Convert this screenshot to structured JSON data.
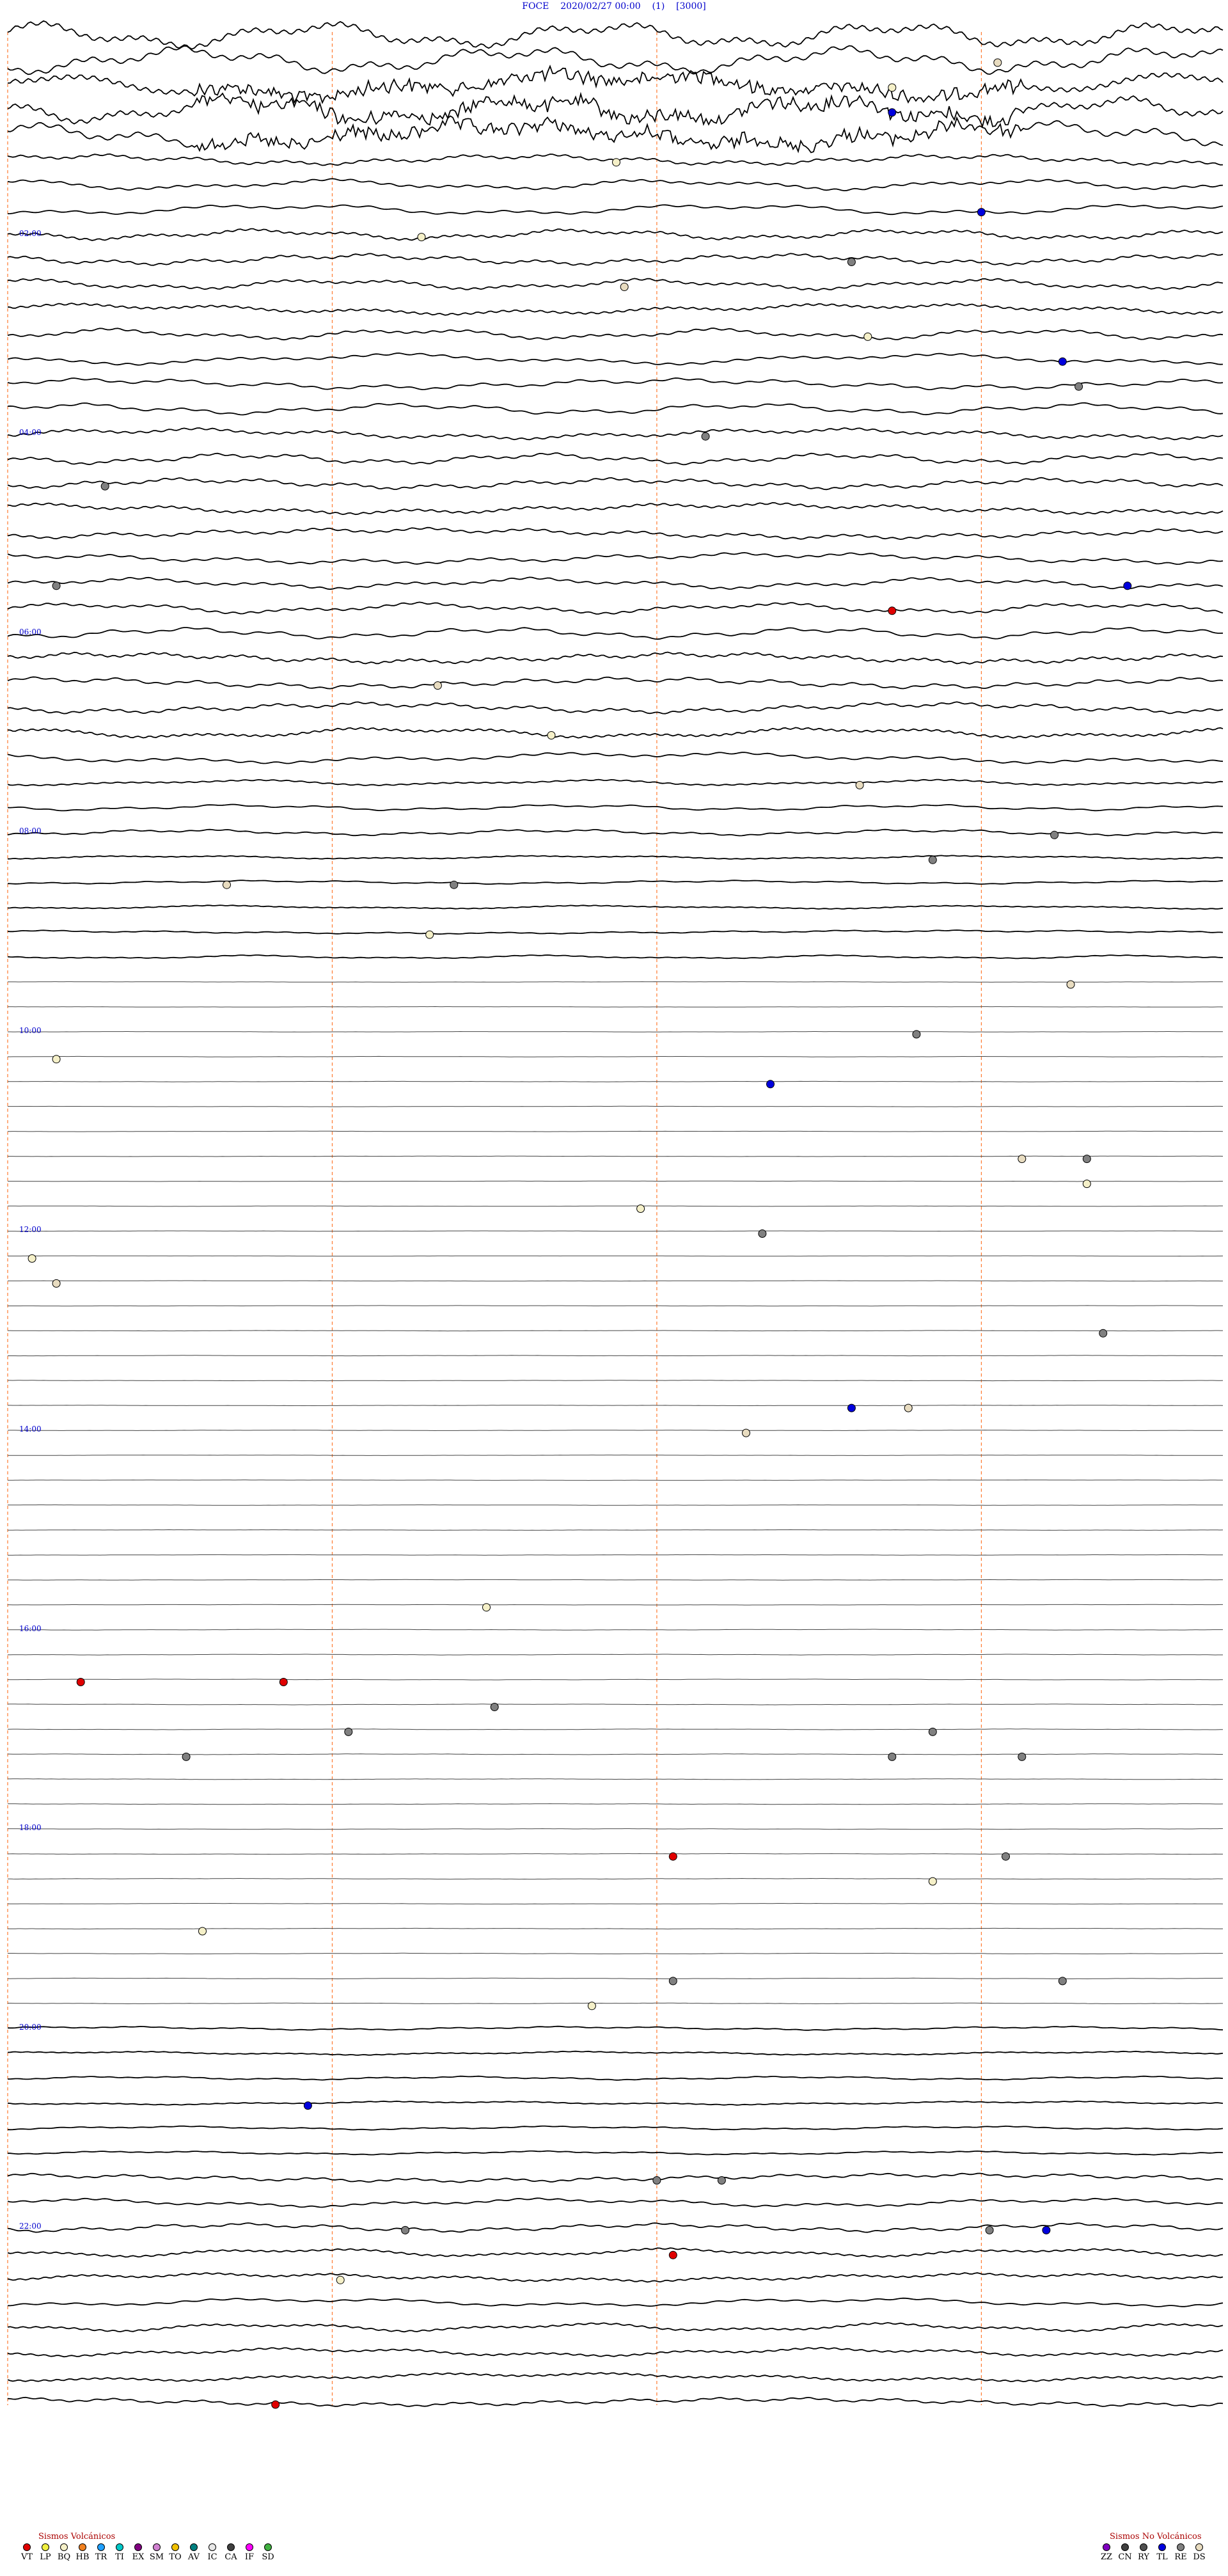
{
  "header": {
    "station": "FOCE",
    "datetime": "2020/02/27 00:00",
    "channel": "(1)",
    "gain": "[3000]"
  },
  "chart_data": {
    "type": "helicorder",
    "rows": 96,
    "row_minutes": 15,
    "hour_labels": [
      "02:00",
      "04:00",
      "06:00",
      "08:00",
      "10:00",
      "12:00",
      "14:00",
      "16:00",
      "18:00",
      "20:00",
      "22:00"
    ],
    "event_colors": {
      "VT": "#e00000",
      "LP": "#f0f040",
      "BQ": "#f5f0c8",
      "HB": "#f08020",
      "TR": "#20a0ff",
      "TI": "#00c8c8",
      "EX": "#800080",
      "SM": "#d080d0",
      "TO": "#f0c000",
      "AV": "#008080",
      "IC": "#e8e8e8",
      "CA": "#404040",
      "IF": "#ff00ff",
      "SD": "#40b040",
      "ZZ": "#8000c0",
      "CN": "#404040",
      "RY": "#505050",
      "TL": "#0000dd",
      "RE": "#808080",
      "DS": "#e8dcc0"
    },
    "events": [
      {
        "row": 1,
        "min": 12.2,
        "type": "DS"
      },
      {
        "row": 2,
        "min": 10.9,
        "type": "BQ"
      },
      {
        "row": 3,
        "min": 10.9,
        "type": "TL"
      },
      {
        "row": 5,
        "min": 7.5,
        "type": "BQ"
      },
      {
        "row": 7,
        "min": 12.0,
        "type": "TL"
      },
      {
        "row": 8,
        "min": 5.1,
        "type": "BQ"
      },
      {
        "row": 9,
        "min": 10.4,
        "type": "RE"
      },
      {
        "row": 10,
        "min": 7.6,
        "type": "DS"
      },
      {
        "row": 12,
        "min": 10.6,
        "type": "BQ"
      },
      {
        "row": 13,
        "min": 13.0,
        "type": "TL"
      },
      {
        "row": 14,
        "min": 13.2,
        "type": "RE"
      },
      {
        "row": 16,
        "min": 8.6,
        "type": "RE"
      },
      {
        "row": 18,
        "min": 1.2,
        "type": "RE"
      },
      {
        "row": 22,
        "min": 0.6,
        "type": "RE"
      },
      {
        "row": 22,
        "min": 13.8,
        "type": "TL"
      },
      {
        "row": 23,
        "min": 10.9,
        "type": "VT"
      },
      {
        "row": 26,
        "min": 5.3,
        "type": "DS"
      },
      {
        "row": 28,
        "min": 6.7,
        "type": "BQ"
      },
      {
        "row": 30,
        "min": 10.5,
        "type": "DS"
      },
      {
        "row": 32,
        "min": 12.9,
        "type": "RE"
      },
      {
        "row": 33,
        "min": 11.4,
        "type": "RE"
      },
      {
        "row": 34,
        "min": 2.7,
        "type": "DS"
      },
      {
        "row": 34,
        "min": 5.5,
        "type": "RE"
      },
      {
        "row": 36,
        "min": 5.2,
        "type": "BQ"
      },
      {
        "row": 38,
        "min": 13.1,
        "type": "DS"
      },
      {
        "row": 40,
        "min": 11.2,
        "type": "RE"
      },
      {
        "row": 41,
        "min": 0.6,
        "type": "BQ"
      },
      {
        "row": 42,
        "min": 9.4,
        "type": "TL"
      },
      {
        "row": 45,
        "min": 12.5,
        "type": "DS"
      },
      {
        "row": 45,
        "min": 13.3,
        "type": "RE"
      },
      {
        "row": 46,
        "min": 13.3,
        "type": "BQ"
      },
      {
        "row": 47,
        "min": 7.8,
        "type": "BQ"
      },
      {
        "row": 48,
        "min": 9.3,
        "type": "RE"
      },
      {
        "row": 49,
        "min": 0.3,
        "type": "BQ"
      },
      {
        "row": 50,
        "min": 0.6,
        "type": "DS"
      },
      {
        "row": 52,
        "min": 13.5,
        "type": "RE"
      },
      {
        "row": 55,
        "min": 10.4,
        "type": "TL"
      },
      {
        "row": 55,
        "min": 11.1,
        "type": "DS"
      },
      {
        "row": 56,
        "min": 9.1,
        "type": "DS"
      },
      {
        "row": 63,
        "min": 5.9,
        "type": "BQ"
      },
      {
        "row": 66,
        "min": 0.9,
        "type": "VT"
      },
      {
        "row": 66,
        "min": 3.4,
        "type": "VT"
      },
      {
        "row": 67,
        "min": 6.0,
        "type": "RE"
      },
      {
        "row": 68,
        "min": 4.2,
        "type": "RE"
      },
      {
        "row": 68,
        "min": 11.4,
        "type": "RE"
      },
      {
        "row": 69,
        "min": 2.2,
        "type": "RE"
      },
      {
        "row": 69,
        "min": 10.9,
        "type": "RE"
      },
      {
        "row": 69,
        "min": 12.5,
        "type": "RE"
      },
      {
        "row": 73,
        "min": 8.2,
        "type": "VT"
      },
      {
        "row": 73,
        "min": 12.3,
        "type": "RE"
      },
      {
        "row": 74,
        "min": 11.4,
        "type": "BQ"
      },
      {
        "row": 76,
        "min": 2.4,
        "type": "BQ"
      },
      {
        "row": 78,
        "min": 8.2,
        "type": "RE"
      },
      {
        "row": 78,
        "min": 13.0,
        "type": "RE"
      },
      {
        "row": 79,
        "min": 7.2,
        "type": "BQ"
      },
      {
        "row": 83,
        "min": 3.7,
        "type": "TL"
      },
      {
        "row": 86,
        "min": 8.0,
        "type": "RE"
      },
      {
        "row": 86,
        "min": 8.8,
        "type": "RE"
      },
      {
        "row": 88,
        "min": 4.9,
        "type": "RE"
      },
      {
        "row": 88,
        "min": 12.1,
        "type": "RE"
      },
      {
        "row": 88,
        "min": 12.8,
        "type": "TL"
      },
      {
        "row": 89,
        "min": 8.2,
        "type": "VT"
      },
      {
        "row": 90,
        "min": 4.1,
        "type": "BQ"
      },
      {
        "row": 95,
        "min": 3.3,
        "type": "VT"
      }
    ],
    "legend": {
      "volcanic_title": "Sismos Volcánicos",
      "volcanic": [
        "VT",
        "LP",
        "BQ",
        "HB",
        "TR",
        "TI",
        "EX",
        "SM",
        "TO",
        "AV",
        "IC",
        "CA",
        "IF",
        "SD"
      ],
      "nonvolcanic_title": "Sismos No Volcánicos",
      "nonvolcanic": [
        "ZZ",
        "CN",
        "RY",
        "TL",
        "RE",
        "DS"
      ]
    }
  }
}
